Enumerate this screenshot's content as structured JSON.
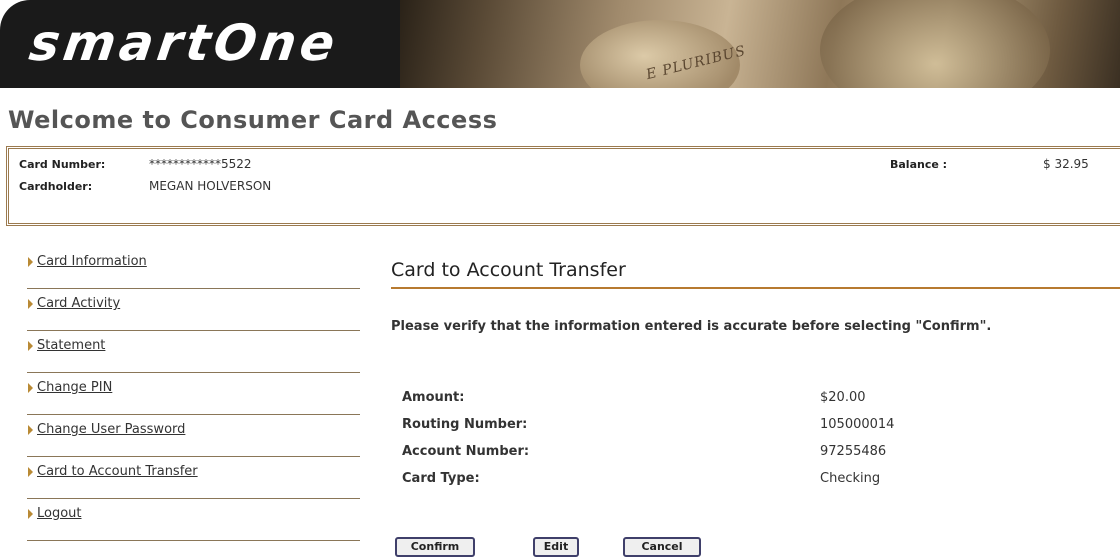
{
  "brand": {
    "logo_text": "smartOne",
    "motto": "E PLURIBUS"
  },
  "welcome": "Welcome to Consumer Card Access",
  "card": {
    "number_label": "Card Number:",
    "number_value": "************5522",
    "holder_label": "Cardholder:",
    "holder_value": "MEGAN HOLVERSON",
    "balance_label": "Balance :",
    "balance_value": "$ 32.95"
  },
  "nav": {
    "items": [
      {
        "label": "Card Information"
      },
      {
        "label": "Card Activity"
      },
      {
        "label": "Statement"
      },
      {
        "label": "Change PIN"
      },
      {
        "label": "Change User Password"
      },
      {
        "label": "Card to Account Transfer"
      },
      {
        "label": "Logout"
      }
    ]
  },
  "main": {
    "title": "Card to Account Transfer",
    "instruction": "Please verify that the information entered is accurate before selecting \"Confirm\".",
    "rows": [
      {
        "label": "Amount:",
        "value": "$20.00"
      },
      {
        "label": "Routing Number:",
        "value": "105000014"
      },
      {
        "label": "Account Number:",
        "value": "97255486"
      },
      {
        "label": "Card Type:",
        "value": "Checking"
      }
    ],
    "buttons": {
      "confirm": "Confirm",
      "edit": "Edit",
      "cancel": "Cancel"
    }
  },
  "colors": {
    "accent": "#b77a30",
    "card_border": "#9b7a4f",
    "banner_bg": "#1a1a1a"
  }
}
